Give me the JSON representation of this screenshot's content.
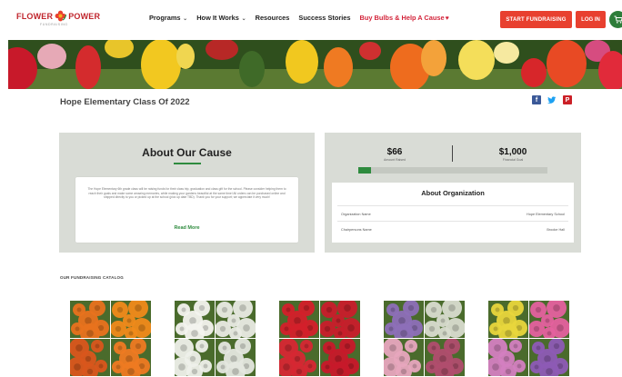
{
  "brand": {
    "logo_left": "FLOWER",
    "logo_right": "POWER",
    "logo_tagline": "FUNDRAISING"
  },
  "nav": {
    "items": [
      {
        "label": "Programs",
        "dropdown": true
      },
      {
        "label": "How It Works",
        "dropdown": true
      },
      {
        "label": "Resources",
        "dropdown": false
      },
      {
        "label": "Success Stories",
        "dropdown": false
      },
      {
        "label": "Buy Bulbs & Help A Cause",
        "dropdown": false,
        "promo": true
      }
    ],
    "start_button": "START FUNDRAISING",
    "login_button": "LOG IN"
  },
  "page": {
    "title": "Hope Elementary Class Of 2022"
  },
  "cause": {
    "heading": "About Our Cause",
    "body": "The Hope Elementary 6th grade class will be raising funds for their class trip, graduation and class gift for the school. Please consider helping them to reach their goals and make some amazing memories, while making your gardens beautiful at the same time! All orders can be purchased online and shipped directly to you or picked up at the school (pick up date TBD). Thank you for your support; we appreciate it very much!",
    "read_more": "Read More"
  },
  "stats": {
    "raised_value": "$66",
    "raised_label": "Amount Raised",
    "goal_value": "$1,000",
    "goal_label": "Financial Goal",
    "progress_fraction": 0.066
  },
  "organization": {
    "heading": "About Organization",
    "rows": [
      {
        "label": "Organization Name",
        "value": "Hope Elementary School"
      },
      {
        "label": "Chairpersons Name",
        "value": "Brooke Hall"
      }
    ]
  },
  "catalog": {
    "label": "OUR FUNDRAISING CATALOG",
    "products": [
      {
        "name": "orange-bulbs",
        "tiles": [
          "#e8721e",
          "#f08a1a",
          "#d9561c",
          "#ee7a22"
        ]
      },
      {
        "name": "white-bulbs",
        "tiles": [
          "#f3f3ee",
          "#e9ebe4",
          "#eef0ea",
          "#e4e7df"
        ]
      },
      {
        "name": "red-bulbs",
        "tiles": [
          "#d3202a",
          "#c81e2b",
          "#d62733",
          "#c7192a"
        ]
      },
      {
        "name": "mixed-purple-bulbs",
        "tiles": [
          "#8d6fb8",
          "#d8dccf",
          "#e7a7be",
          "#b04d6e"
        ]
      },
      {
        "name": "mixed-yellow-bulbs",
        "tiles": [
          "#e8d63c",
          "#e4619e",
          "#d37fc0",
          "#8d5bb5"
        ]
      }
    ]
  },
  "colors": {
    "accent_red": "#e8402f",
    "accent_green": "#2e8b3e",
    "panel_gray": "#d9dcd6"
  },
  "icons": {
    "social": [
      "facebook-icon",
      "twitter-icon",
      "pinterest-icon"
    ],
    "cart": "cart-icon"
  }
}
